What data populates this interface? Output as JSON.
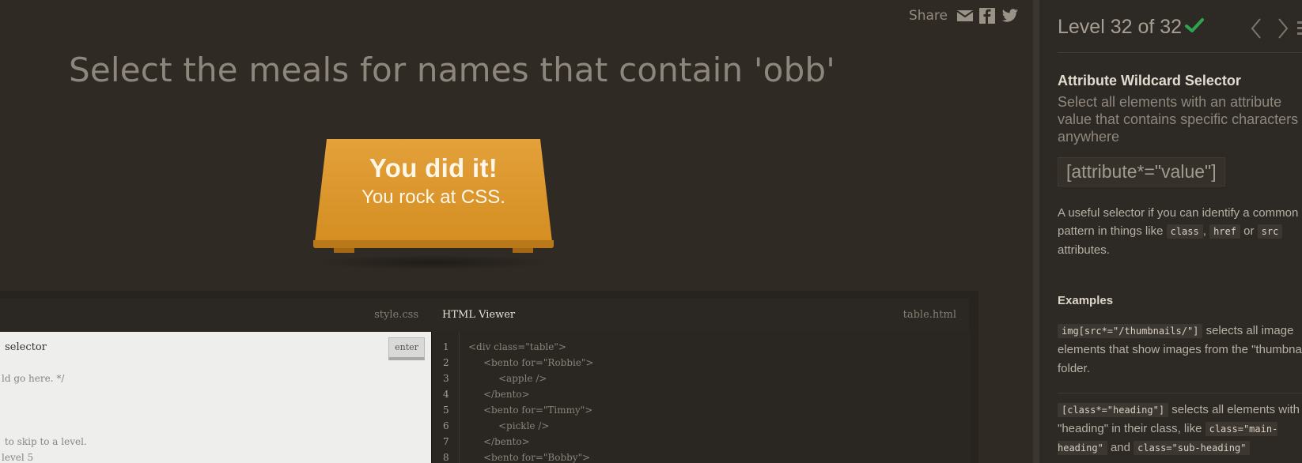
{
  "game": {
    "share_label": "Share",
    "instruction": "Select the meals for names that contain 'obb'",
    "win_line1": "You did it!",
    "win_line2": "You rock at CSS."
  },
  "css_editor": {
    "filename": "style.css",
    "lines": [
      " selector",
      "ld go here. */",
      "",
      "",
      " to skip to a level.",
      "level 5"
    ],
    "enter_label": "enter"
  },
  "html_viewer": {
    "name": "HTML Viewer",
    "filename": "table.html",
    "line_numbers": [
      "1",
      "2",
      "3",
      "4",
      "5",
      "6",
      "7",
      "8"
    ],
    "lines": [
      "<div class=\"table\">",
      "<bento for=\"Robbie\">",
      "<apple />",
      "</bento>",
      "<bento for=\"Timmy\">",
      "<pickle />",
      "</bento>",
      "<bento for=\"Bobby\">"
    ]
  },
  "sidebar": {
    "level_text": "Level 32 of 32",
    "selector_name": "Attribute Wildcard Selector",
    "selector_title": "Select all elements with an attribute value that contains specific characters anywhere",
    "syntax": "[attribute*=\"value\"]",
    "hint_pre": "A useful selector if you can identify a common pattern in things like",
    "hint_code1": "class",
    "hint_sep1": ",",
    "hint_code2": "href",
    "hint_sep2": "or",
    "hint_code3": "src",
    "hint_post": "attributes.",
    "examples_title": "Examples",
    "ex1_code": "img[src*=\"/thumbnails/\"]",
    "ex1_text": "selects all image elements that show images from the \"thumbnails\" folder.",
    "ex2_code": "[class*=\"heading\"]",
    "ex2_text_a": "selects all elements with \"heading\" in their class, like",
    "ex2_code2": "class=\"main-heading\"",
    "ex2_and": "and",
    "ex2_code3": "class=\"sub-heading\""
  },
  "colors": {
    "accent": "#2fa44f",
    "table": "#dc962b",
    "background": "#2f2a24"
  },
  "icons": [
    "envelope-icon",
    "facebook-icon",
    "twitter-icon",
    "checkmark-icon",
    "chevron-left-icon",
    "chevron-right-icon",
    "menu-icon"
  ]
}
